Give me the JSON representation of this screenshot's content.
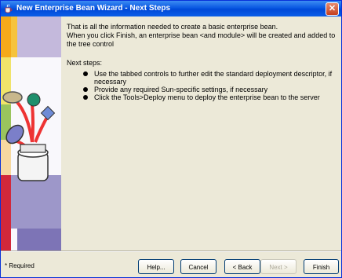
{
  "window": {
    "title": "New Enterprise Bean Wizard - Next Steps",
    "close_label": "✕"
  },
  "content": {
    "intro_line1": "That is all the information needed to create a basic enterprise bean.",
    "intro_line2": "When you click Finish, an enterprise bean <and module> will be created and added to the tree control",
    "next_heading": "Next steps:",
    "steps": [
      "Use the tabbed controls to further edit the standard deployment descriptor, if necessary",
      "Provide any required Sun-specific settings, if necessary",
      "Click the Tools>Deploy menu to deploy the enterprise bean to the server"
    ]
  },
  "footer": {
    "required_note": "* Required",
    "help": "Help...",
    "cancel": "Cancel",
    "back": "< Back",
    "next": "Next >",
    "finish": "Finish"
  },
  "colors": {
    "title_bar": "#0a58e2",
    "panel": "#ece9d8",
    "accent": "#003c74"
  }
}
